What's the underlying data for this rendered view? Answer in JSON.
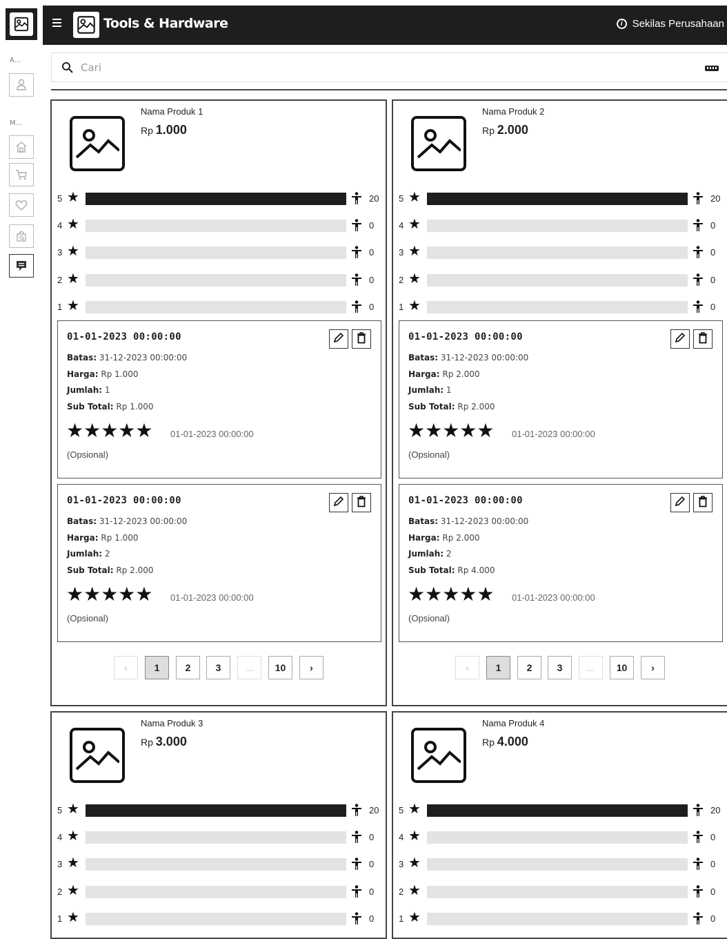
{
  "rail": {
    "section_a": "A...",
    "section_m": "M..."
  },
  "topbar": {
    "title": "Tools & Hardware",
    "right_link": "Sekilas Perusahaan"
  },
  "search": {
    "placeholder": "Cari"
  },
  "products": [
    {
      "name": "Nama Produk 1",
      "currency": "Rp",
      "price": "1.000",
      "ratings": [
        {
          "star": "5",
          "count": "20",
          "fill": 1.0
        },
        {
          "star": "4",
          "count": "0",
          "fill": 0
        },
        {
          "star": "3",
          "count": "0",
          "fill": 0
        },
        {
          "star": "2",
          "count": "0",
          "fill": 0
        },
        {
          "star": "1",
          "count": "0",
          "fill": 0
        }
      ],
      "transactions": [
        {
          "date": "01-01-2023 00:00:00",
          "batas_label": "Batas:",
          "batas": "31-12-2023 00:00:00",
          "harga_label": "Harga:",
          "harga": "Rp 1.000",
          "jumlah_label": "Jumlah:",
          "jumlah": "1",
          "subtotal_label": "Sub Total:",
          "subtotal": "Rp 1.000",
          "stars": "★★★★★",
          "review_date": "01-01-2023 00:00:00",
          "note": "(Opsional)"
        },
        {
          "date": "01-01-2023 00:00:00",
          "batas_label": "Batas:",
          "batas": "31-12-2023 00:00:00",
          "harga_label": "Harga:",
          "harga": "Rp 1.000",
          "jumlah_label": "Jumlah:",
          "jumlah": "2",
          "subtotal_label": "Sub Total:",
          "subtotal": "Rp 2.000",
          "stars": "★★★★★",
          "review_date": "01-01-2023 00:00:00",
          "note": "(Opsional)"
        }
      ],
      "pager": {
        "prev": "‹",
        "pages": [
          "1",
          "2",
          "3"
        ],
        "ellipsis": "...",
        "last": "10",
        "next": "›"
      }
    },
    {
      "name": "Nama Produk 2",
      "currency": "Rp",
      "price": "2.000",
      "ratings": [
        {
          "star": "5",
          "count": "20",
          "fill": 1.0
        },
        {
          "star": "4",
          "count": "0",
          "fill": 0
        },
        {
          "star": "3",
          "count": "0",
          "fill": 0
        },
        {
          "star": "2",
          "count": "0",
          "fill": 0
        },
        {
          "star": "1",
          "count": "0",
          "fill": 0
        }
      ],
      "transactions": [
        {
          "date": "01-01-2023 00:00:00",
          "batas_label": "Batas:",
          "batas": "31-12-2023 00:00:00",
          "harga_label": "Harga:",
          "harga": "Rp 2.000",
          "jumlah_label": "Jumlah:",
          "jumlah": "1",
          "subtotal_label": "Sub Total:",
          "subtotal": "Rp 2.000",
          "stars": "★★★★★",
          "review_date": "01-01-2023 00:00:00",
          "note": "(Opsional)"
        },
        {
          "date": "01-01-2023 00:00:00",
          "batas_label": "Batas:",
          "batas": "31-12-2023 00:00:00",
          "harga_label": "Harga:",
          "harga": "Rp 2.000",
          "jumlah_label": "Jumlah:",
          "jumlah": "2",
          "subtotal_label": "Sub Total:",
          "subtotal": "Rp 4.000",
          "stars": "★★★★★",
          "review_date": "01-01-2023 00:00:00",
          "note": "(Opsional)"
        }
      ],
      "pager": {
        "prev": "‹",
        "pages": [
          "1",
          "2",
          "3"
        ],
        "ellipsis": "...",
        "last": "10",
        "next": "›"
      }
    },
    {
      "name": "Nama Produk 3",
      "currency": "Rp",
      "price": "3.000",
      "ratings": [
        {
          "star": "5",
          "count": "20",
          "fill": 1.0
        },
        {
          "star": "4",
          "count": "0",
          "fill": 0
        },
        {
          "star": "3",
          "count": "0",
          "fill": 0
        },
        {
          "star": "2",
          "count": "0",
          "fill": 0
        },
        {
          "star": "1",
          "count": "0",
          "fill": 0
        }
      ]
    },
    {
      "name": "Nama Produk 4",
      "currency": "Rp",
      "price": "4.000",
      "ratings": [
        {
          "star": "5",
          "count": "20",
          "fill": 1.0
        },
        {
          "star": "4",
          "count": "0",
          "fill": 0
        },
        {
          "star": "3",
          "count": "0",
          "fill": 0
        },
        {
          "star": "2",
          "count": "0",
          "fill": 0
        },
        {
          "star": "1",
          "count": "0",
          "fill": 0
        }
      ]
    }
  ],
  "icons": {
    "rail": [
      "image-logo-icon",
      "user-icon",
      "home-icon",
      "cart-icon",
      "heart-icon",
      "bag-search-icon",
      "chat-icon"
    ],
    "topbar": [
      "menu-icon",
      "image-logo-icon",
      "info-icon"
    ],
    "search": [
      "search-icon",
      "keyboard-icon"
    ],
    "card": [
      "image-placeholder-icon",
      "star-icon",
      "person-icon",
      "pencil-icon",
      "trash-icon"
    ]
  }
}
